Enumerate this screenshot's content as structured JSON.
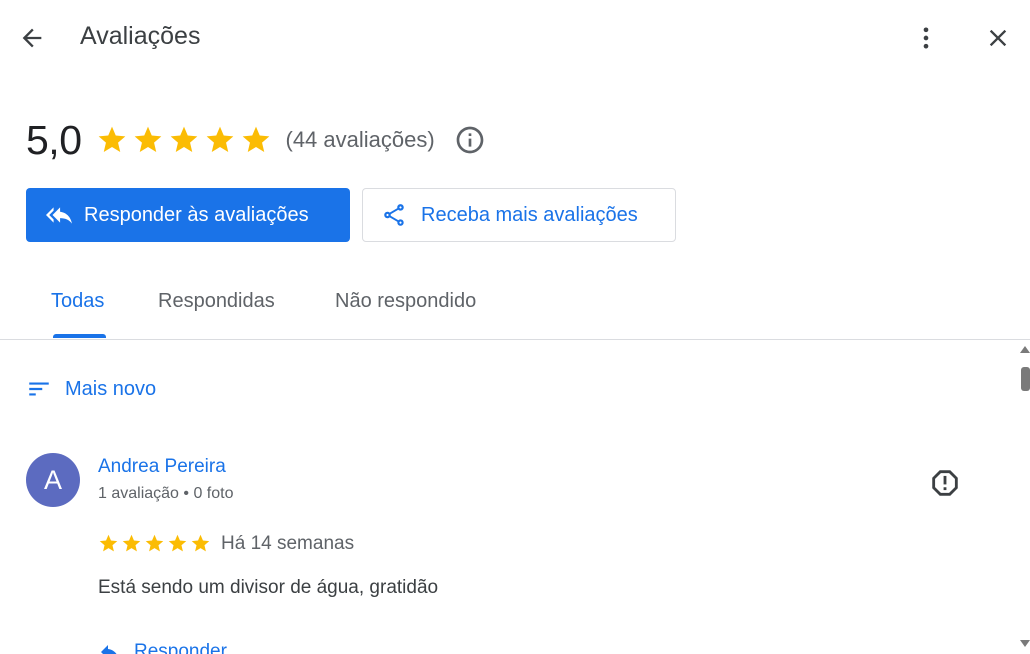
{
  "header": {
    "title": "Avaliações",
    "back_icon": "arrow-back-icon",
    "more_icon": "more-vert-icon",
    "close_icon": "close-icon"
  },
  "summary": {
    "score": "5,0",
    "stars": 5,
    "count": "(44 avaliações)",
    "info_icon": "info-icon"
  },
  "actions": {
    "respond_label": "Responder às avaliações",
    "respond_icon": "reply-all-icon",
    "get_more_label": "Receba mais avaliações",
    "get_more_icon": "share-icon"
  },
  "tabs": [
    {
      "label": "Todas",
      "active": true
    },
    {
      "label": "Respondidas",
      "active": false
    },
    {
      "label": "Não respondido",
      "active": false
    }
  ],
  "sort": {
    "label": "Mais novo",
    "icon": "sort-icon"
  },
  "review": {
    "avatar_letter": "A",
    "reviewer_name": "Andrea Pereira",
    "reviewer_meta": "1 avaliação • 0 foto",
    "rating": 5,
    "time": "Há 14 semanas",
    "text": "Está sendo um divisor de água, gratidão",
    "reply_label": "Responder",
    "flag_icon": "report-icon"
  },
  "colors": {
    "accent": "#1a73e8",
    "star": "#fbbc04",
    "avatar": "#5c6bc0",
    "text_secondary": "#5f6368"
  }
}
